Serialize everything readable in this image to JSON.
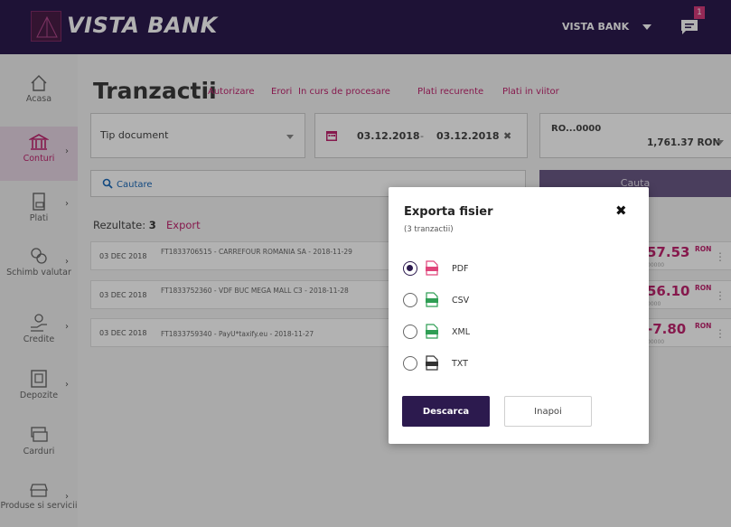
{
  "header": {
    "logo_text": "VISTA BANK",
    "bank_menu": "VISTA BANK",
    "notification_count": "1"
  },
  "sidebar": {
    "items": [
      {
        "label": "Acasa",
        "icon": "home-icon"
      },
      {
        "label": "Conturi",
        "icon": "bank-icon"
      },
      {
        "label": "Plati",
        "icon": "payments-icon"
      },
      {
        "label": "Schimb valutar",
        "icon": "exchange-icon"
      },
      {
        "label": "Credite",
        "icon": "credit-icon"
      },
      {
        "label": "Depozite",
        "icon": "deposit-icon"
      },
      {
        "label": "Carduri",
        "icon": "cards-icon"
      },
      {
        "label": "Produse si servicii",
        "icon": "products-icon"
      }
    ]
  },
  "main": {
    "title": "Tranzactii",
    "tabs": [
      "Autorizare",
      "Erori",
      "In curs de procesare",
      "Plati recurente",
      "Plati in viitor"
    ],
    "doc_type": "Tip document",
    "date_from": "03.12.2018",
    "date_sep": "-",
    "date_to": "03.12.2018",
    "account": "RO...0000",
    "balance": "1,761.37 RON",
    "search_placeholder": "Cautare",
    "search_button": "Cauta",
    "results_label": "Rezultate:",
    "results_count": "3",
    "export_link": "Export"
  },
  "transactions": [
    {
      "date": "03 DEC 2018",
      "desc": "FT1833706515 - CARREFOUR ROMANIA SA - 2018-11-29",
      "amount": "57.53",
      "currency": "RON",
      "sub": "00000"
    },
    {
      "date": "03 DEC 2018",
      "desc": "FT1833752360 - VDF BUC MEGA MALL C3 - 2018-11-28",
      "amount": "56.10",
      "currency": "RON",
      "sub": "0000"
    },
    {
      "date": "03 DEC 2018",
      "desc": "FT1833759340 - PayU*taxify.eu - 2018-11-27",
      "amount": "-7.80",
      "currency": "RON",
      "sub": "00000"
    }
  ],
  "modal": {
    "title": "Exporta fisier",
    "subtitle": "(3 tranzactii)",
    "options": [
      {
        "label": "PDF",
        "icon": "pdf-file-icon",
        "color": "#e0457b"
      },
      {
        "label": "CSV",
        "icon": "csv-file-icon",
        "color": "#2f9e54"
      },
      {
        "label": "XML",
        "icon": "xml-file-icon",
        "color": "#2f9e54"
      },
      {
        "label": "TXT",
        "icon": "txt-file-icon",
        "color": "#333333"
      }
    ],
    "download_button": "Descarca",
    "back_button": "Inapoi"
  },
  "colors": {
    "brand_dark": "#2c1a4e",
    "accent": "#c0256f"
  }
}
